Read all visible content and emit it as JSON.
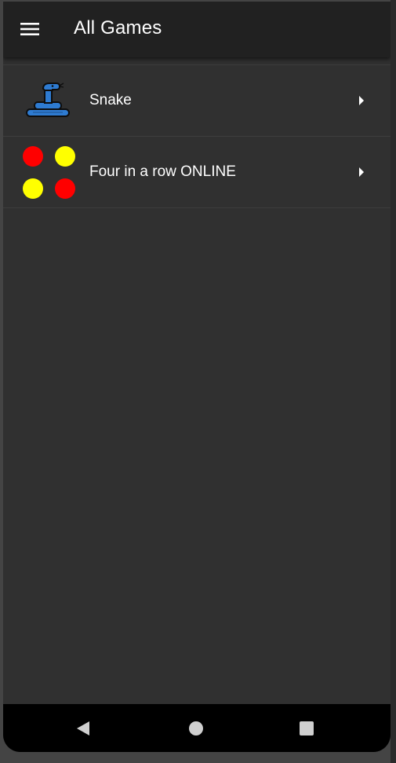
{
  "appbar": {
    "title": "All Games",
    "menu_icon": "hamburger-menu-icon"
  },
  "games": [
    {
      "label": "Snake",
      "icon": "snake-icon",
      "trailing_icon": "chevron-right-icon"
    },
    {
      "label": "Four in a row ONLINE",
      "icon": "four-dots-icon",
      "trailing_icon": "chevron-right-icon"
    }
  ],
  "navbar": {
    "back_icon": "back-triangle-icon",
    "home_icon": "home-circle-icon",
    "recents_icon": "recents-square-icon"
  },
  "colors": {
    "appbar_bg": "#212121",
    "screen_bg": "#303030",
    "snake_blue": "#2e7bd1",
    "dot_red": "#ff0000",
    "dot_yellow": "#ffff00"
  }
}
